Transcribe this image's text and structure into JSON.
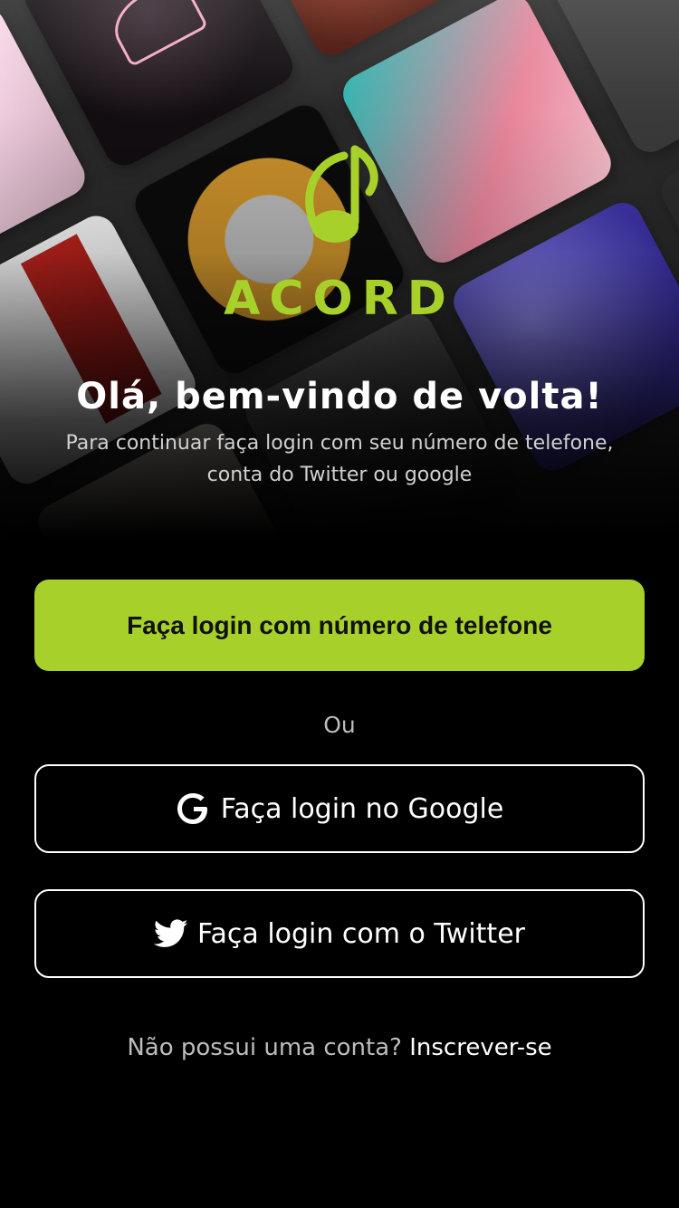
{
  "brand": {
    "name": "ACORD",
    "accent_color": "#a7d12a",
    "logo_icon": "music-note-icon"
  },
  "hero": {
    "headline": "Olá, bem-vindo de volta!",
    "subtitle_line1": "Para continuar faça login com seu número de telefone,",
    "subtitle_line2": "conta do Twitter ou google"
  },
  "actions": {
    "phone_login_label": "Faça login com número de telefone",
    "or_label": "Ou",
    "google_login_label": "Faça login no Google",
    "google_icon": "google-icon",
    "twitter_login_label": "Faça login com o Twitter",
    "twitter_icon": "twitter-icon"
  },
  "footer": {
    "no_account_text": "Não possui uma conta?",
    "signup_link": "Inscrever-se"
  }
}
